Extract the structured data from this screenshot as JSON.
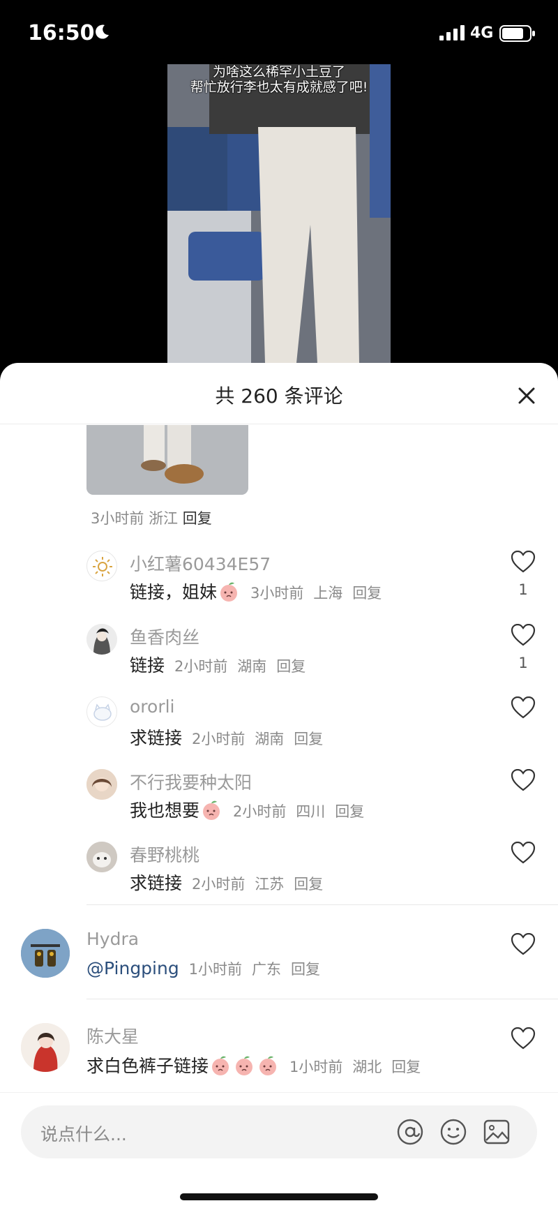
{
  "status": {
    "time": "16:50",
    "network": "4G"
  },
  "video": {
    "caption_line1": "为啥这么稀罕小土豆了",
    "caption_line2": "帮忙放行李也太有成就感了吧!"
  },
  "sheet": {
    "title": "共 260 条评论"
  },
  "parent_comment": {
    "time": "3小时前",
    "location": "浙江",
    "reply": "回复"
  },
  "replies": [
    {
      "user": "小红薯60434E57",
      "text": "链接，姐妹",
      "time": "3小时前",
      "location": "上海",
      "reply": "回复",
      "likes": "1"
    },
    {
      "user": "鱼香肉丝",
      "text": "链接",
      "time": "2小时前",
      "location": "湖南",
      "reply": "回复",
      "likes": "1"
    },
    {
      "user": "ororli",
      "text": "求链接",
      "time": "2小时前",
      "location": "湖南",
      "reply": "回复",
      "likes": ""
    },
    {
      "user": "不行我要种太阳",
      "text": "我也想要",
      "time": "2小时前",
      "location": "四川",
      "reply": "回复",
      "likes": ""
    },
    {
      "user": "春野桃桃",
      "text": "求链接",
      "time": "2小时前",
      "location": "江苏",
      "reply": "回复",
      "likes": ""
    }
  ],
  "top_comments": [
    {
      "user": "Hydra",
      "mention": "@Pingping",
      "time": "1小时前",
      "location": "广东",
      "reply": "回复"
    },
    {
      "user": "陈大星",
      "text": "求白色裤子链接",
      "time": "1小时前",
      "location": "湖北",
      "reply": "回复"
    }
  ],
  "input": {
    "placeholder": "说点什么..."
  },
  "icons": {
    "close": "close-icon",
    "heart": "heart-icon",
    "mention": "at-icon",
    "emoji": "emoji-icon",
    "image": "image-icon",
    "moon": "moon-icon",
    "signal": "signal-icon",
    "battery": "battery-icon"
  },
  "colors": {
    "mention": "#2c4f7c",
    "muted": "#8a8a8a",
    "text": "#222222"
  }
}
